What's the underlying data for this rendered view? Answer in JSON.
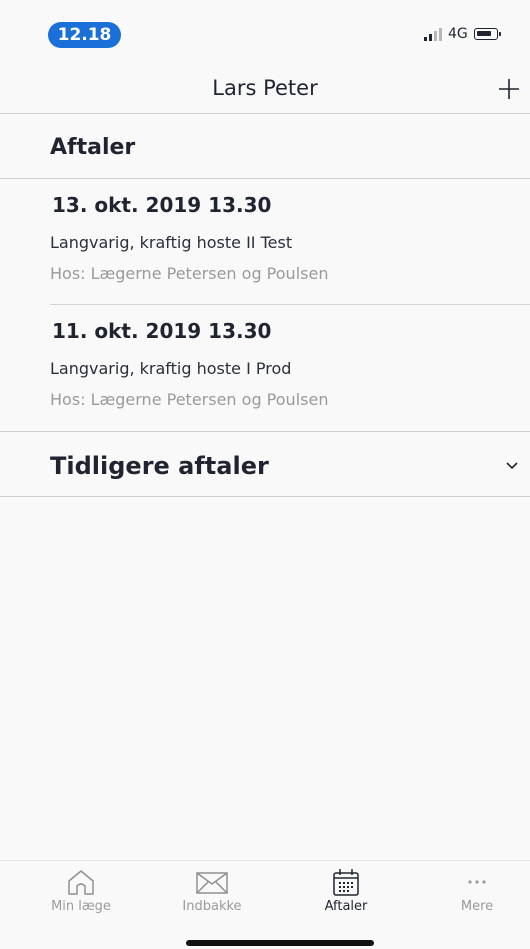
{
  "status_bar": {
    "time": "12.18",
    "network": "4G"
  },
  "nav": {
    "title": "Lars Peter",
    "add_icon": "plus-icon"
  },
  "appointments_section": {
    "title": "Aftaler",
    "items": [
      {
        "date": "13. okt. 2019 13.30",
        "reason": "Langvarig, kraftig hoste II Test",
        "clinic": "Hos: Lægerne Petersen og Poulsen"
      },
      {
        "date": "11. okt. 2019 13.30",
        "reason": "Langvarig, kraftig hoste I Prod",
        "clinic": "Hos: Lægerne Petersen og Poulsen"
      }
    ]
  },
  "earlier_section": {
    "title": "Tidligere aftaler",
    "toggle_icon": "chevron-down-icon"
  },
  "tab_bar": {
    "tabs": [
      {
        "label": "Min læge",
        "icon": "house-icon",
        "active": false
      },
      {
        "label": "Indbakke",
        "icon": "envelope-icon",
        "active": false
      },
      {
        "label": "Aftaler",
        "icon": "calendar-icon",
        "active": true
      },
      {
        "label": "Mere",
        "icon": "more-dots-icon",
        "active": false
      }
    ]
  },
  "colors": {
    "accent": "#1b6fd8",
    "text": "#1f2430",
    "muted": "#9a9a9a",
    "background": "#f9f9f9"
  }
}
